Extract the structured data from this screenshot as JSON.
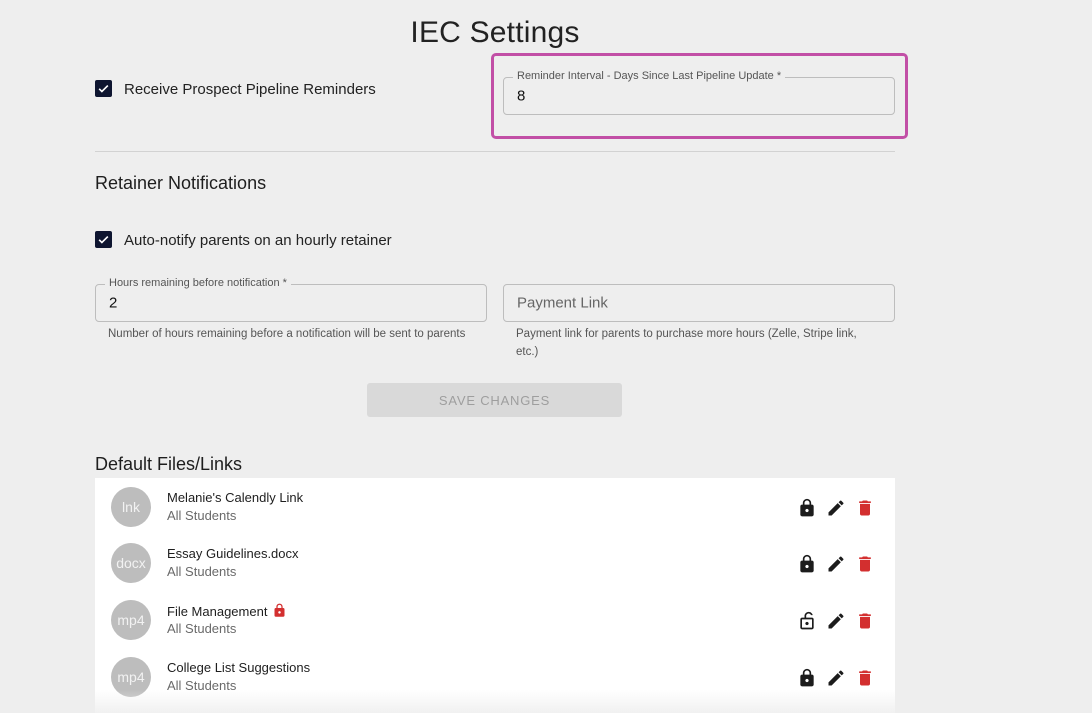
{
  "page": {
    "title": "IEC Settings"
  },
  "pipeline": {
    "checkbox_label": "Receive Prospect Pipeline Reminders",
    "checked": true,
    "interval_label": "Reminder Interval - Days Since Last Pipeline Update *",
    "interval_value": "8"
  },
  "retainer": {
    "section_title": "Retainer Notifications",
    "checkbox_label": "Auto-notify parents on an hourly retainer",
    "checked": true,
    "hours_label": "Hours remaining before notification *",
    "hours_value": "2",
    "hours_helper": "Number of hours remaining before a notification will be sent to parents",
    "payment_placeholder": "Payment Link",
    "payment_helper": "Payment link for parents to purchase more hours (Zelle, Stripe link, etc.)"
  },
  "actions": {
    "save_label": "SAVE CHANGES"
  },
  "files": {
    "section_title": "Default Files/Links",
    "items": [
      {
        "avatar": "lnk",
        "name": "Melanie's Calendly Link",
        "audience": "All Students",
        "locked": true,
        "name_lock_badge": false
      },
      {
        "avatar": "docx",
        "name": "Essay Guidelines.docx",
        "audience": "All Students",
        "locked": true,
        "name_lock_badge": false
      },
      {
        "avatar": "mp4",
        "name": "File Management",
        "audience": "All Students",
        "locked": false,
        "name_lock_badge": true
      },
      {
        "avatar": "mp4",
        "name": "College List Suggestions",
        "audience": "All Students",
        "locked": true,
        "name_lock_badge": false
      }
    ]
  },
  "colors": {
    "highlight": "#c24fa6",
    "checkbox": "#0e1530",
    "delete": "#d32f2f",
    "lock_badge": "#d32f2f"
  }
}
